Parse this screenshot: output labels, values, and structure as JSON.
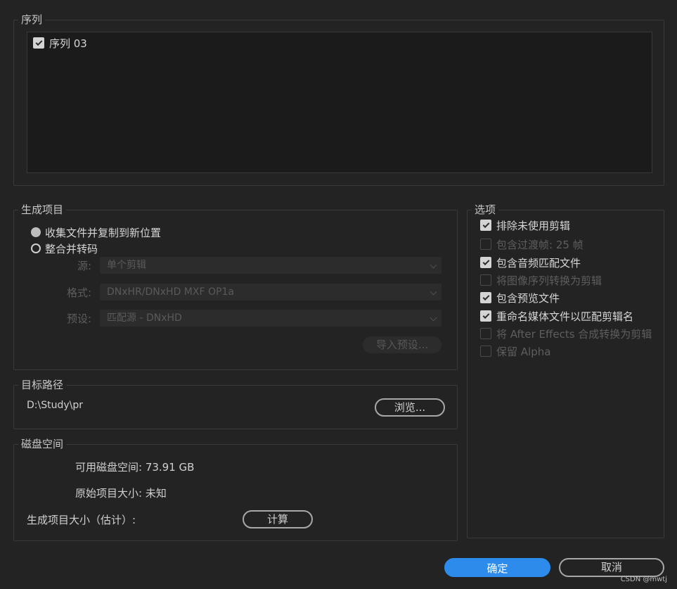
{
  "sequence": {
    "legend": "序列",
    "items": [
      {
        "label": "序列 03",
        "checked": true
      }
    ]
  },
  "generate": {
    "legend": "生成项目",
    "radio_collect": "收集文件并复制到新位置",
    "radio_consolidate": "整合并转码",
    "source_label": "源:",
    "source_value": "单个剪辑",
    "format_label": "格式:",
    "format_value": "DNxHR/DNxHD MXF OP1a",
    "preset_label": "预设:",
    "preset_value": "匹配源 - DNxHD",
    "import_preset": "导入预设..."
  },
  "target": {
    "legend": "目标路径",
    "path": "D:\\Study\\pr",
    "browse": "浏览..."
  },
  "disk": {
    "legend": "磁盘空间",
    "available": "可用磁盘空间: 73.91 GB",
    "original": "原始项目大小: 未知",
    "estimate": "生成项目大小（估计）:",
    "compute": "计算"
  },
  "options": {
    "legend": "选项",
    "items": [
      {
        "label": "排除未使用剪辑",
        "checked": true,
        "enabled": true
      },
      {
        "label": "包含过渡帧: 25 帧",
        "checked": false,
        "enabled": false
      },
      {
        "label": "包含音频匹配文件",
        "checked": true,
        "enabled": true
      },
      {
        "label": "将图像序列转换为剪辑",
        "checked": false,
        "enabled": false
      },
      {
        "label": "包含预览文件",
        "checked": true,
        "enabled": true
      },
      {
        "label": "重命名媒体文件以匹配剪辑名",
        "checked": true,
        "enabled": true
      },
      {
        "label": "将 After Effects 合成转换为剪辑",
        "checked": false,
        "enabled": false
      },
      {
        "label": "保留 Alpha",
        "checked": false,
        "enabled": false
      }
    ]
  },
  "footer": {
    "ok": "确定",
    "cancel": "取消",
    "watermark": "CSDN @mwtj"
  }
}
